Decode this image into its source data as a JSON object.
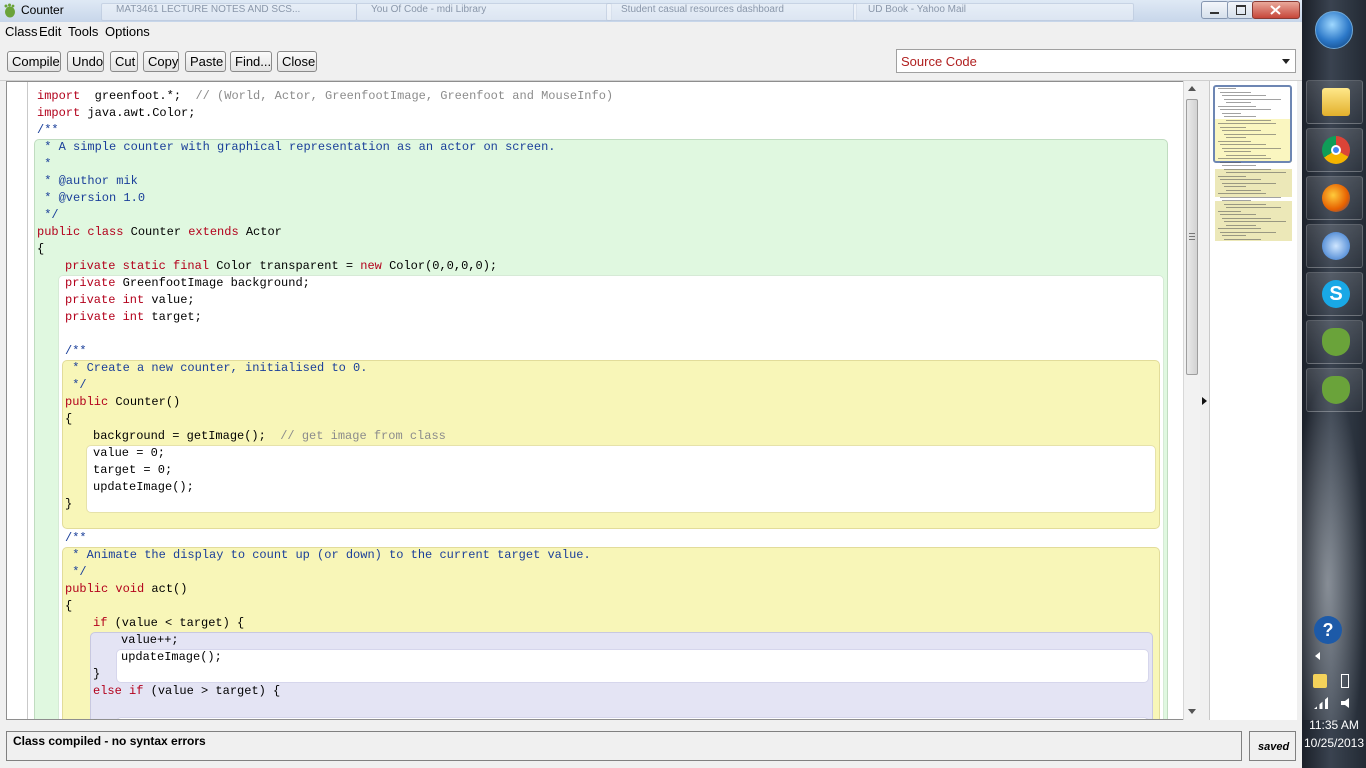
{
  "window": {
    "title": "Counter",
    "background_tabs": [
      "MAT3461 LECTURE NOTES AND SCS...",
      "You Of Code - mdi Library",
      "Student casual resources dashboard",
      "UD Book - Yahoo Mail"
    ]
  },
  "menu": {
    "items": [
      "Class",
      "Edit",
      "Tools",
      "Options"
    ]
  },
  "toolbar": {
    "compile": "Compile",
    "undo": "Undo",
    "cut": "Cut",
    "copy": "Copy",
    "paste": "Paste",
    "find": "Find...",
    "close": "Close",
    "view_selected": "Source Code"
  },
  "code": {
    "lines": [
      [
        [
          "kw",
          "import"
        ],
        [
          "",
          "  greenfoot.*;  "
        ],
        [
          "cmt",
          "// (World, Actor, GreenfootImage, Greenfoot and MouseInfo)"
        ]
      ],
      [
        [
          "kw",
          "import"
        ],
        [
          "",
          " java.awt.Color;"
        ]
      ],
      [
        [
          "doc",
          "/**"
        ]
      ],
      [
        [
          "doc",
          " * A simple counter with graphical representation as an actor on screen."
        ]
      ],
      [
        [
          "doc",
          " *"
        ]
      ],
      [
        [
          "doc",
          " * @author mik"
        ]
      ],
      [
        [
          "doc",
          " * @version 1.0"
        ]
      ],
      [
        [
          "doc",
          " */"
        ]
      ],
      [
        [
          "kw",
          "public class"
        ],
        [
          "",
          " Counter "
        ],
        [
          "kw",
          "extends"
        ],
        [
          "",
          " Actor"
        ]
      ],
      [
        [
          "",
          "{"
        ]
      ],
      [
        [
          "kw",
          "private static final"
        ],
        [
          "",
          " Color transparent = "
        ],
        [
          "kw",
          "new"
        ],
        [
          "",
          " Color(0,0,0,0);"
        ]
      ],
      [
        [
          "kw",
          "private"
        ],
        [
          "",
          " GreenfootImage background;"
        ]
      ],
      [
        [
          "kw",
          "private int"
        ],
        [
          "",
          " value;"
        ]
      ],
      [
        [
          "kw",
          "private int"
        ],
        [
          "",
          " target;"
        ]
      ],
      [
        [
          "",
          ""
        ]
      ],
      [
        [
          "doc",
          "/**"
        ]
      ],
      [
        [
          "doc",
          " * Create a new counter, initialised to 0."
        ]
      ],
      [
        [
          "doc",
          " */"
        ]
      ],
      [
        [
          "kw",
          "public"
        ],
        [
          "",
          " Counter()"
        ]
      ],
      [
        [
          "",
          "{"
        ]
      ],
      [
        [
          "",
          "background = getImage();  "
        ],
        [
          "cmt",
          "// get image from class"
        ]
      ],
      [
        [
          "",
          "value = 0;"
        ]
      ],
      [
        [
          "",
          "target = 0;"
        ]
      ],
      [
        [
          "",
          "updateImage();"
        ]
      ],
      [
        [
          "",
          "}"
        ]
      ],
      [
        [
          "",
          ""
        ]
      ],
      [
        [
          "doc",
          "/**"
        ]
      ],
      [
        [
          "doc",
          " * Animate the display to count up (or down) to the current target value."
        ]
      ],
      [
        [
          "doc",
          " */"
        ]
      ],
      [
        [
          "kw",
          "public void"
        ],
        [
          "",
          " act()"
        ]
      ],
      [
        [
          "",
          "{"
        ]
      ],
      [
        [
          "kw",
          "if"
        ],
        [
          "",
          " (value < target) {"
        ]
      ],
      [
        [
          "",
          "value++;"
        ]
      ],
      [
        [
          "",
          "updateImage();"
        ]
      ],
      [
        [
          "",
          "}"
        ]
      ],
      [
        [
          "kw",
          "else if"
        ],
        [
          "",
          " (value > target) {"
        ]
      ]
    ]
  },
  "status": {
    "message": "Class compiled - no syntax errors",
    "saved": "saved"
  },
  "taskbar": {
    "apps": [
      "folder-icon",
      "chrome-icon",
      "firefox-icon",
      "network-icon",
      "skype-icon",
      "greenfoot-icon",
      "greenfoot-icon"
    ],
    "time": "11:35 AM",
    "date": "10/25/2013"
  }
}
